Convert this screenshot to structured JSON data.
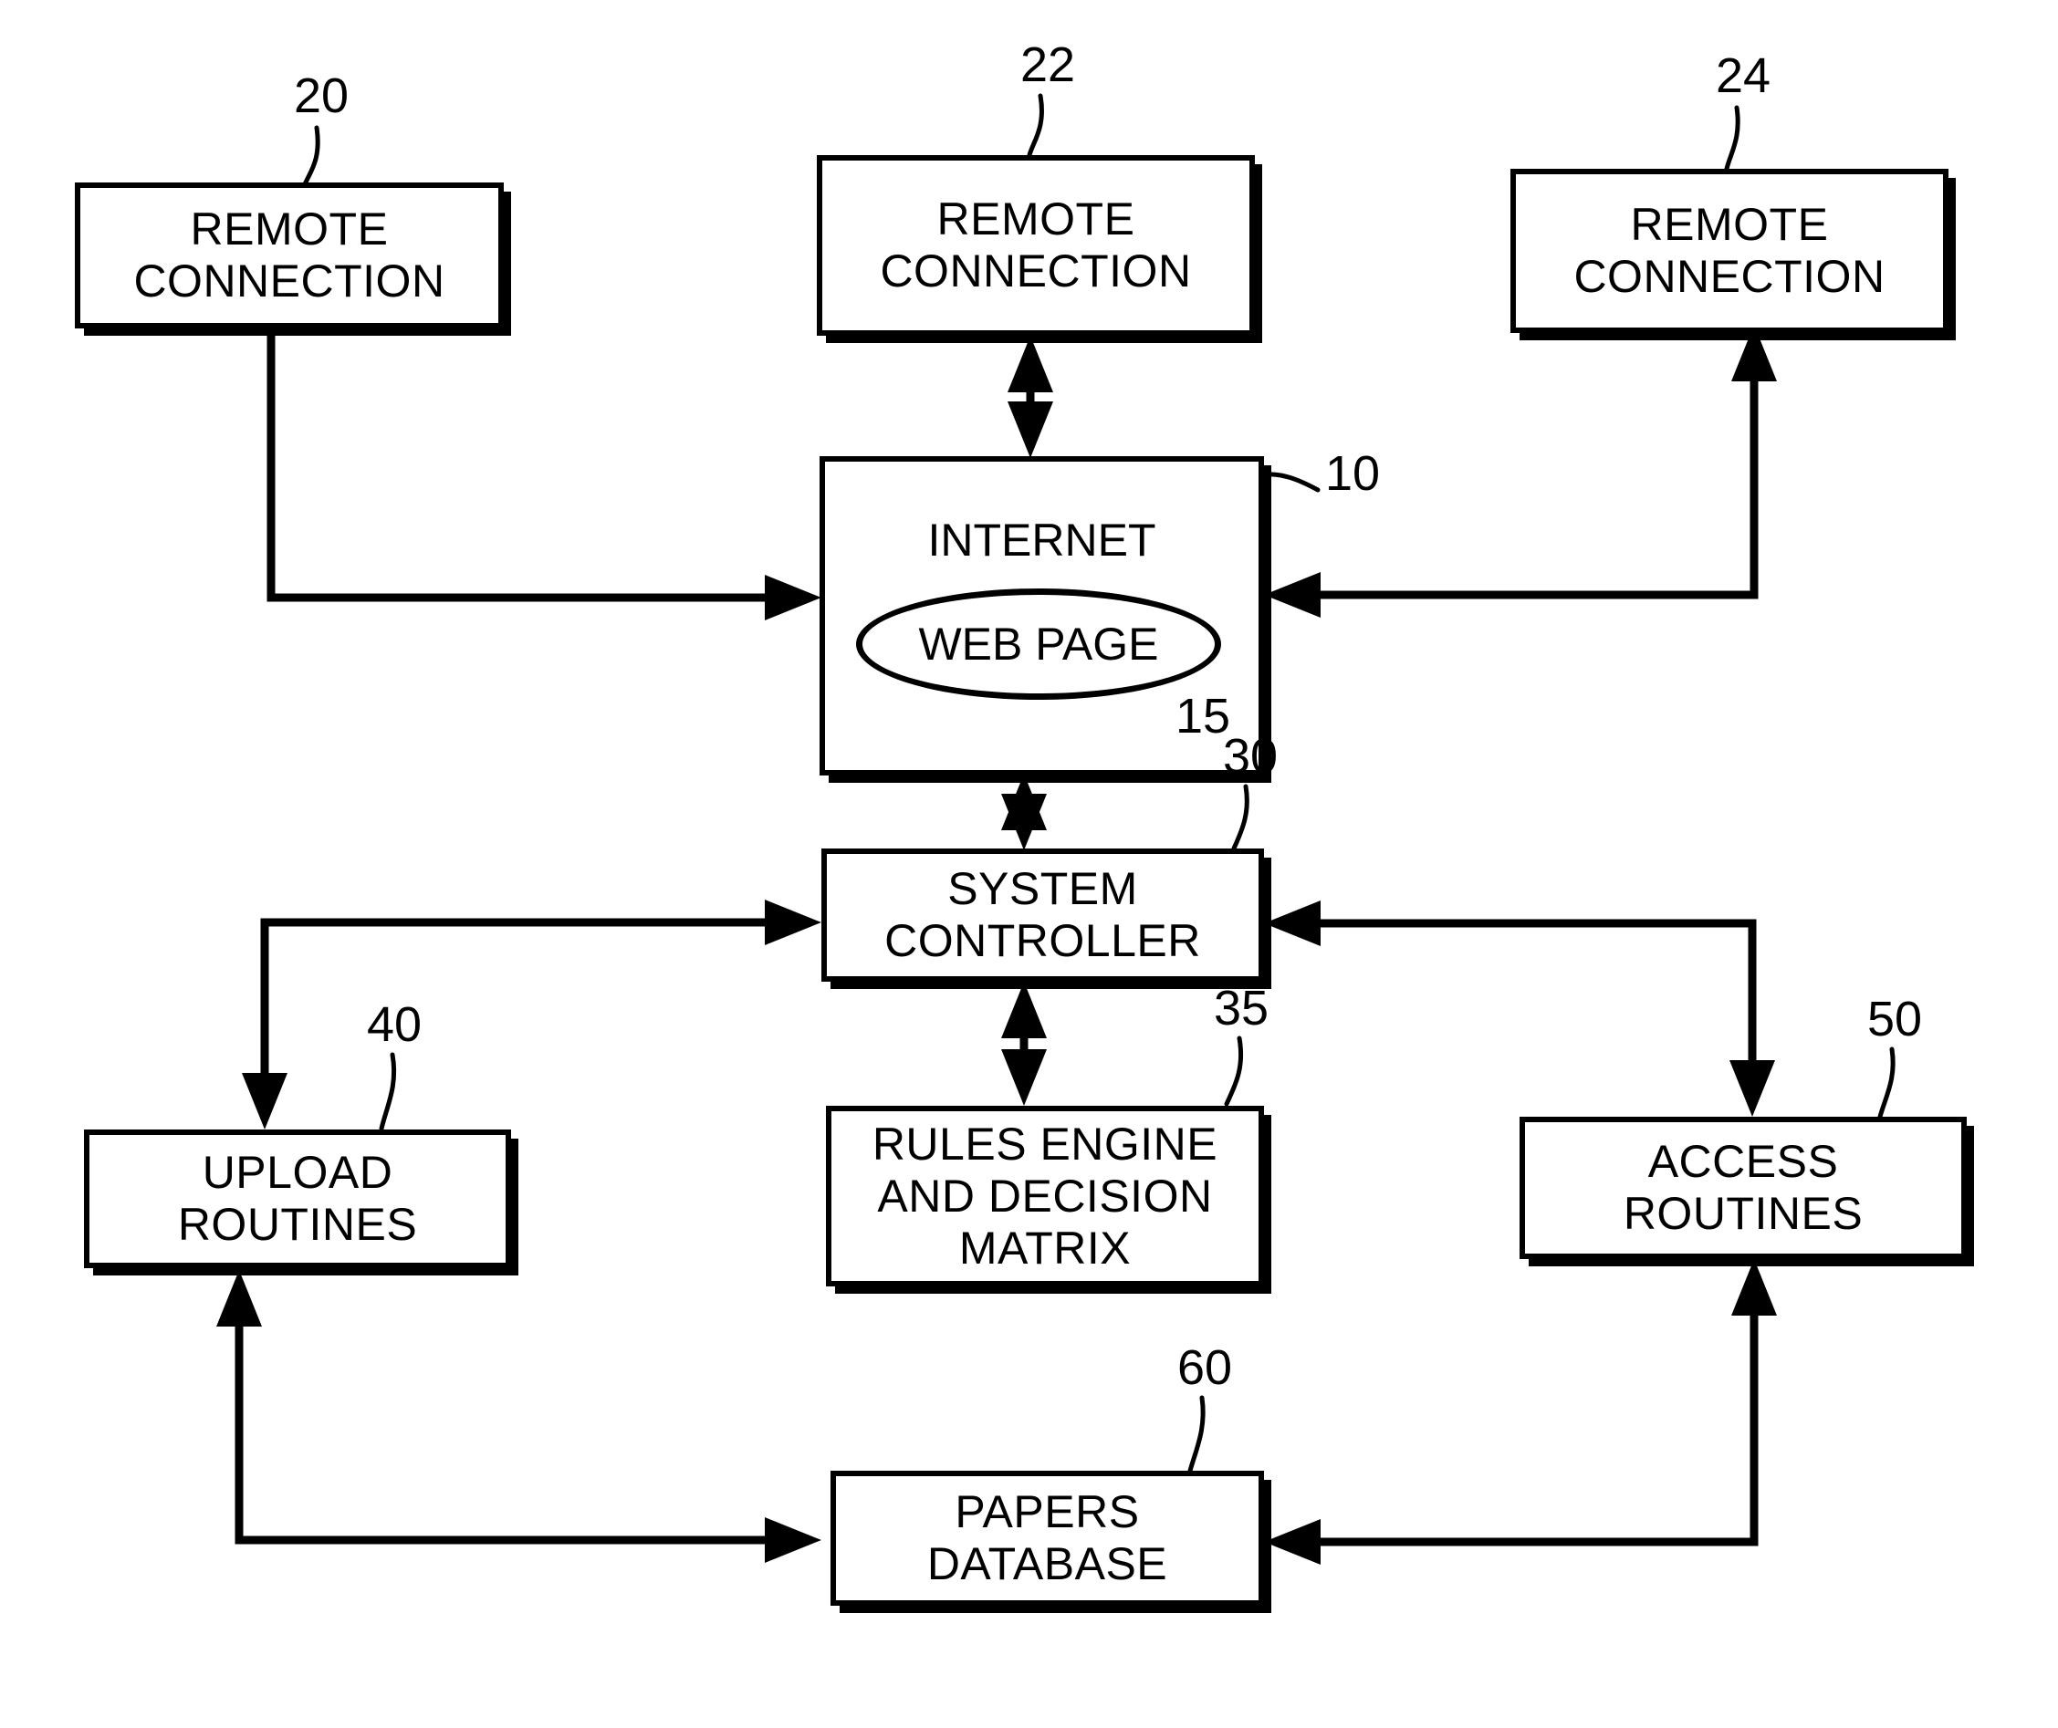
{
  "figure": {
    "type": "patent-block-diagram",
    "background_color": "#ffffff",
    "line_color": "#000000"
  },
  "nodes": {
    "remote_connection_left": {
      "line1": "REMOTE",
      "line2": "CONNECTION",
      "ref": "20"
    },
    "remote_connection_center": {
      "line1": "REMOTE",
      "line2": "CONNECTION",
      "ref": "22"
    },
    "remote_connection_right": {
      "line1": "REMOTE",
      "line2": "CONNECTION",
      "ref": "24"
    },
    "internet": {
      "label": "INTERNET",
      "ref": "10"
    },
    "web_page": {
      "label": "WEB PAGE",
      "ref": "15"
    },
    "system_controller": {
      "line1": "SYSTEM",
      "line2": "CONTROLLER",
      "ref": "30"
    },
    "rules_engine": {
      "line1": "RULES ENGINE",
      "line2": "AND DECISION",
      "line3": "MATRIX",
      "ref": "35"
    },
    "upload_routines": {
      "line1": "UPLOAD",
      "line2": "ROUTINES",
      "ref": "40"
    },
    "access_routines": {
      "line1": "ACCESS",
      "line2": "ROUTINES",
      "ref": "50"
    },
    "papers_database": {
      "line1": "PAPERS",
      "line2": "DATABASE",
      "ref": "60"
    }
  }
}
